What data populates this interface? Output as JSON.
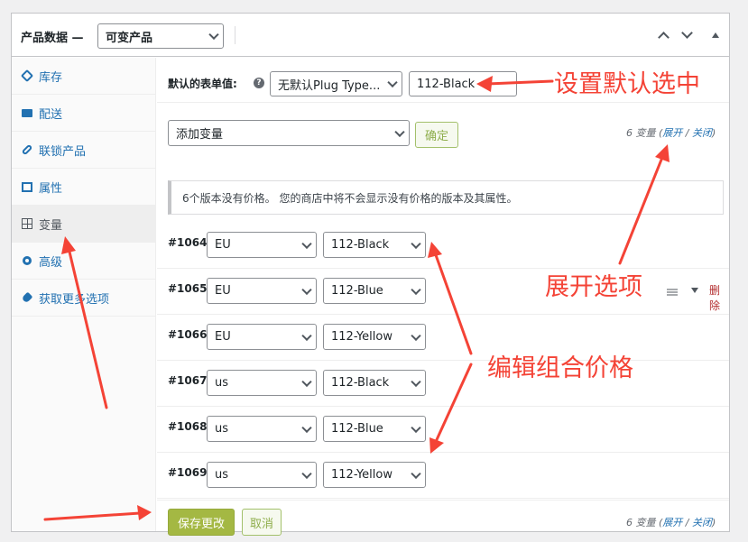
{
  "header": {
    "title": "产品数据 —",
    "product_type": "可变产品"
  },
  "sidebar": {
    "items": [
      {
        "label": "库存",
        "icon": "tag-icon"
      },
      {
        "label": "配送",
        "icon": "truck-icon"
      },
      {
        "label": "联锁产品",
        "icon": "link-icon"
      },
      {
        "label": "属性",
        "icon": "list-icon"
      },
      {
        "label": "变量",
        "icon": "grid-icon"
      },
      {
        "label": "高级",
        "icon": "gear-icon"
      },
      {
        "label": "获取更多选项",
        "icon": "plug-icon"
      }
    ],
    "active_index": 4
  },
  "defaults": {
    "label": "默认的表单值:",
    "type_select": "无默认Plug Type...",
    "color_select": "112-Black"
  },
  "add_variation": {
    "select": "添加变量",
    "confirm": "确定"
  },
  "count": {
    "text": "6 变量 (",
    "expand": "展开",
    "sep": " / ",
    "close": "关闭",
    "end": ")"
  },
  "notice": "6个版本没有价格。 您的商店中将不会显示没有价格的版本及其属性。",
  "variations": [
    {
      "id": "#1064",
      "region": "EU",
      "color": "112-Black"
    },
    {
      "id": "#1065",
      "region": "EU",
      "color": "112-Blue",
      "remove": "删除"
    },
    {
      "id": "#1066",
      "region": "EU",
      "color": "112-Yellow"
    },
    {
      "id": "#1067",
      "region": "us",
      "color": "112-Black"
    },
    {
      "id": "#1068",
      "region": "us",
      "color": "112-Blue"
    },
    {
      "id": "#1069",
      "region": "us",
      "color": "112-Yellow"
    }
  ],
  "footer": {
    "save": "保存更改",
    "cancel": "取消"
  },
  "annotations": {
    "set_default": "设置默认选中",
    "expand_options": "展开选项",
    "edit_price": "编辑组合价格"
  },
  "colors": {
    "annotation": "#f44336",
    "save_button": "#a4b843",
    "link": "#2271b1",
    "remove": "#b32d2e"
  }
}
